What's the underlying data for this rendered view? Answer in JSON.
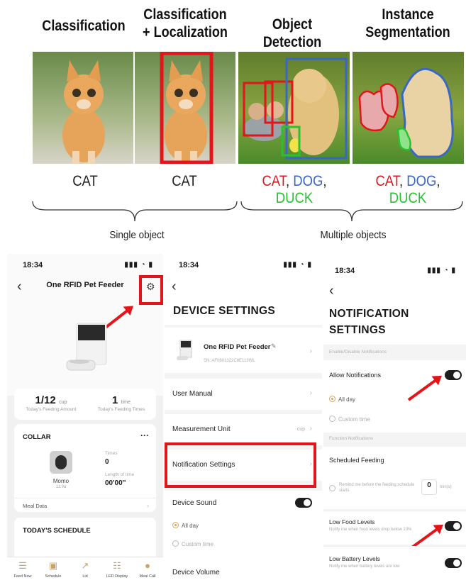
{
  "cv": {
    "titles": [
      "Classification",
      "Classification\n+ Localization",
      "Object Detection",
      "Instance\nSegmentation"
    ],
    "labels": {
      "classification": "CAT",
      "localization": "CAT",
      "detection": {
        "cat": "CAT",
        "sep1": ", ",
        "dog": "DOG",
        "sep2": ", ",
        "duck": "DUCK"
      },
      "segmentation": {
        "cat": "CAT",
        "sep1": ", ",
        "dog": "DOG",
        "sep2": ", ",
        "duck": "DUCK"
      }
    },
    "groups": {
      "single": "Single object",
      "multiple": "Multiple objects"
    }
  },
  "screen1": {
    "time": "18:34",
    "signal": "▮▮▮ ◔ ▮",
    "title": "One RFID Pet Feeder",
    "feeding_amount": "1/12",
    "feeding_amount_unit": "cup",
    "feeding_amount_label": "Today's Feeding Amount",
    "feeding_times": "1",
    "feeding_times_unit": "time",
    "feeding_times_label": "Today's Feeding Times",
    "collar_title": "COLLAR",
    "more": "···",
    "pet_name": "Momo",
    "pet_id": "11:9a",
    "times_label": "Times",
    "times_value": "0",
    "length_label": "Length of time",
    "length_value": "00'00''",
    "meal_data": "Meal Data",
    "schedule_title": "TODAY'S SCHEDULE",
    "tabs": [
      {
        "icon": "☰",
        "label": "Feed Now"
      },
      {
        "icon": "▣",
        "label": "Schedule"
      },
      {
        "icon": "↗",
        "label": "Lid"
      },
      {
        "icon": "☷",
        "label": "LED Display"
      },
      {
        "icon": "●",
        "label": "Meal Call"
      }
    ]
  },
  "screen2": {
    "time": "18:34",
    "signal": "▮▮▮ ◔ ▮",
    "title": "DEVICE SETTINGS",
    "device_name": "One RFID Pet Feeder",
    "device_sn": "SN: AF0601322C8E113WL",
    "user_manual": "User Manual",
    "measurement_unit": "Measurement Unit",
    "measurement_value": "cup",
    "notification_settings": "Notification Settings",
    "device_sound": "Device Sound",
    "all_day": "All day",
    "custom_time": "Custom time",
    "device_volume": "Device Volume"
  },
  "screen3": {
    "time": "18:34",
    "signal": "▮▮▮ ◔ ▮",
    "title_line1": "NOTIFICATION",
    "title_line2": "SETTINGS",
    "enable_section": "Enable/Disable Notifications",
    "allow_notifications": "Allow Notifications",
    "all_day": "All day",
    "custom_time": "Custom time",
    "function_section": "Function Notifications",
    "scheduled_feeding": "Scheduled Feeding",
    "remind_text": "Remind me before the feeding schedule starts",
    "remind_value": "0",
    "remind_unit": "min(s)",
    "low_food": "Low Food Levels",
    "low_food_sub": "Notify me when food levels drop below 10%",
    "low_battery": "Low Battery Levels",
    "low_battery_sub": "Notify me when battery levels are low"
  },
  "colors": {
    "highlight_red": "#e3141a",
    "cat_red": "#d21f26",
    "dog_blue": "#3a67c4",
    "duck_green": "#28c230"
  }
}
